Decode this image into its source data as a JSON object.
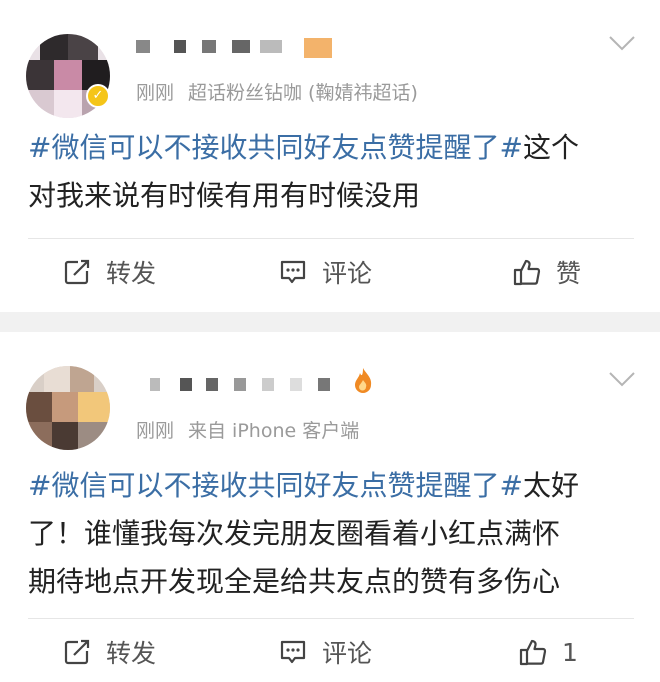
{
  "posts": [
    {
      "meta": {
        "time": "刚刚",
        "source": "超话粉丝钻咖 (鞠婧祎超话)"
      },
      "text": {
        "topic": "#微信可以不接收共同好友点赞提醒了#",
        "line1_rest": "这个",
        "line2": "对我来说有时候有用有时候没用"
      },
      "actions": {
        "repost_label": "转发",
        "comment_label": "评论",
        "like_label": "赞"
      },
      "icons": {
        "more": "chevron-down-icon",
        "repost": "repost-icon",
        "comment": "comment-icon",
        "like": "thumbs-up-icon",
        "badge": "verified-badge-icon"
      }
    },
    {
      "meta": {
        "time": "刚刚",
        "source": "来自 iPhone 客户端"
      },
      "text": {
        "topic": "#微信可以不接收共同好友点赞提醒了#",
        "line1_rest": "太好",
        "line2": "了！谁懂我每次发完朋友圈看着小红点满怀",
        "line3": "期待地点开发现全是给共友点的赞有多伤心"
      },
      "actions": {
        "repost_label": "转发",
        "comment_label": "评论",
        "like_count": "1"
      },
      "icons": {
        "more": "chevron-down-icon",
        "repost": "repost-icon",
        "comment": "comment-icon",
        "like": "thumbs-up-icon",
        "badge": "fire-badge-icon"
      }
    }
  ],
  "colors": {
    "topic_link": "#3b6ea5",
    "meta_gray": "#9a9a9a",
    "separator": "#f1f1f1",
    "badge_gold": "#f5c518",
    "badge_orange": "#f08a24"
  }
}
